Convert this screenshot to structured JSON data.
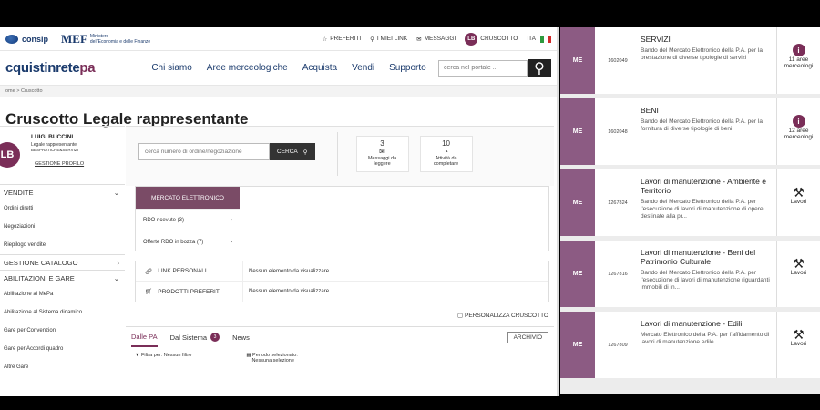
{
  "topbar": {
    "consip": "consip",
    "mef": "MEF",
    "mef_sub1": "Ministero",
    "mef_sub2": "dell'Economia e delle Finanze",
    "preferiti": "PREFERITI",
    "miei_link": "I MIEI LINK",
    "messaggi": "MESSAGGI",
    "avatar": "LB",
    "cruscotto": "CRUSCOTTO",
    "lang": "ITA"
  },
  "navbar": {
    "brand_a": "cquistinrete",
    "brand_b": "pa",
    "items": [
      "Chi siamo",
      "Aree merceologiche",
      "Acquista",
      "Vendi",
      "Supporto"
    ],
    "search_placeholder": "cerca nel portale ..."
  },
  "breadcrumb": {
    "home": "ome",
    "sep": ">",
    "current": "Cruscotto"
  },
  "page_title": "Cruscotto Legale rappresentante",
  "profile": {
    "avatar": "LB",
    "name": "LUIGI BUCCINI",
    "role": "Legale rappresentante",
    "org": "BBSPRATICHE&SERVIZI",
    "link": "GESTIONE PROFILO"
  },
  "sidebar": {
    "vendite": "VENDITE",
    "vendite_items": [
      "Ordini diretti",
      "Negoziazioni",
      "Riepilogo vendite"
    ],
    "catalogo": "GESTIONE CATALOGO",
    "abilitazioni": "ABILITAZIONI E GARE",
    "abil_items": [
      "Abilitazione al MePa",
      "Abilitazione al Sistema dinamico",
      "Gare per Convenzioni",
      "Gare per Accordi quadro",
      "Altre Gare"
    ]
  },
  "searchbox": {
    "placeholder": "cerca numero di ordine/negoziazione",
    "button": "CERCA"
  },
  "stats": [
    {
      "num": "3",
      "label1": "Messaggi da",
      "label2": "leggere"
    },
    {
      "num": "10",
      "label1": "Attività da",
      "label2": "completare"
    }
  ],
  "mercato": {
    "tab": "MERCATO ELETTRONICO",
    "rows": [
      "RDO ricevute (3)",
      "Offerte RDO in bozza (7)"
    ]
  },
  "links": [
    {
      "label": "LINK PERSONALI",
      "value": "Nessun elemento da visualizzare"
    },
    {
      "label": "PRODOTTI PREFERITI",
      "value": "Nessun elemento da visualizzare"
    }
  ],
  "personalizza": "PERSONALIZZA CRUSCOTTO",
  "tabs": {
    "dalle_pa": "Dalle PA",
    "dal_sistema": "Dal Sistema",
    "dal_sistema_count": "3",
    "news": "News",
    "archivio": "ARCHIVIO"
  },
  "filters": {
    "filtra": "Filtra per: Nessun filtro",
    "periodo1": "Periodo selezionato:",
    "periodo2": "Nessuna selezione"
  },
  "cards": [
    {
      "me": "ME",
      "code": "1602049",
      "title": "SERVIZI",
      "desc": "Bando del Mercato Elettronico della P.A. per la prestazione di diverse tipologie di servizi",
      "side1": "11 aree",
      "side2": "merceologi",
      "icon": "info"
    },
    {
      "me": "ME",
      "code": "1602048",
      "title": "BENI",
      "desc": "Bando del Mercato Elettronico della P.A. per la fornitura di diverse tipologie di beni",
      "side1": "12 aree",
      "side2": "merceologi",
      "icon": "info"
    },
    {
      "me": "ME",
      "code": "1267824",
      "title": "Lavori di manutenzione - Ambiente e Territorio",
      "desc": "Bando del Mercato Elettronico della P.A. per l'esecuzione di lavori di manutenzione di opere destinate alla pr...",
      "side1": "Lavori",
      "side2": "",
      "icon": "tools"
    },
    {
      "me": "ME",
      "code": "1267816",
      "title": "Lavori di manutenzione - Beni del Patrimonio Culturale",
      "desc": "Bando del Mercato Elettronico della P.A. per l'esecuzione di lavori di manutenzione riguardanti immobili di in...",
      "side1": "Lavori",
      "side2": "",
      "icon": "tools"
    },
    {
      "me": "ME",
      "code": "1267809",
      "title": "Lavori di manutenzione - Edili",
      "desc": "Mercato Elettronico della P.A. per l'affidamento di lavori di manutenzione edile",
      "side1": "Lavori",
      "side2": "",
      "icon": "tools"
    }
  ],
  "colors": {
    "brand": "#7a2e58",
    "me_tile": "#8c5b83",
    "navy": "#1a3a6c"
  }
}
